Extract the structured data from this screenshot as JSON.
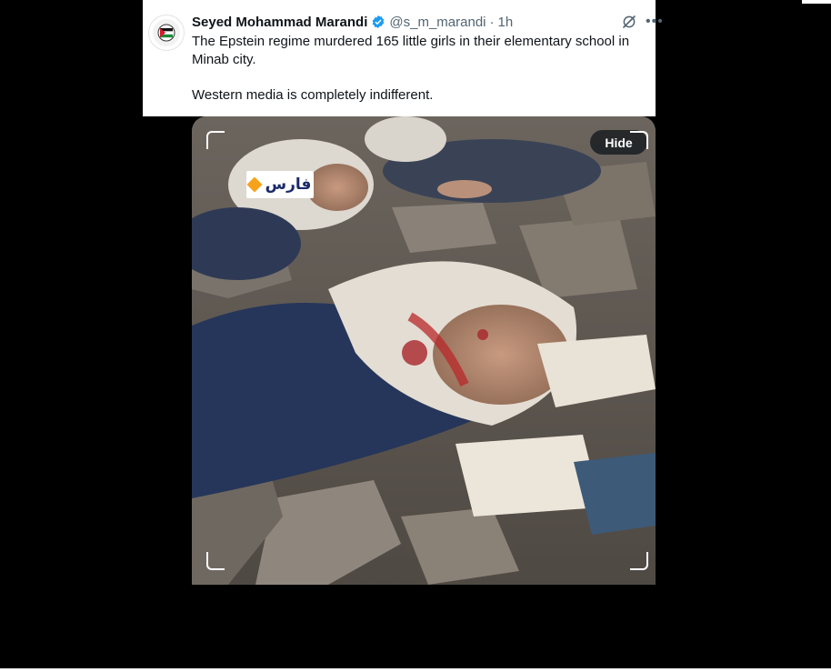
{
  "tweet": {
    "author_name": "Seyed Mohammad Marandi",
    "handle": "@s_m_marandi",
    "separator": "·",
    "time": "1h",
    "text_line1": "The Epstein regime murdered 165 little girls in their elementary school in Minab city.",
    "text_line2": "Western media is completely indifferent.",
    "verified": true,
    "icons": [
      "grok-icon",
      "more-icon",
      "verified-badge-icon"
    ]
  },
  "media": {
    "hide_label": "Hide",
    "watermark_text": "فارس",
    "accent_color": "#f6a21a"
  },
  "colors": {
    "verified": "#1d9bf0",
    "text": "#0f1419",
    "secondary": "#536471",
    "background": "#000000"
  }
}
